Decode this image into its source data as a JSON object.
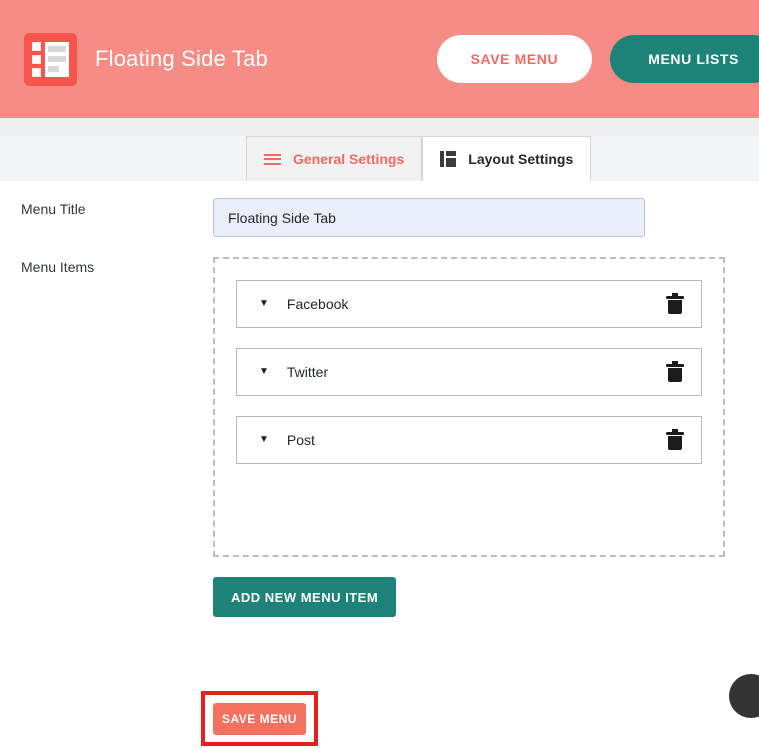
{
  "header": {
    "brand_title": "Floating Side Tab",
    "logo_icon": "side-tab-layout-icon",
    "background_color": "#f58c85",
    "buttons": {
      "save_menu_label": "SAVE MENU",
      "menu_lists_label": "MENU LISTS",
      "menu_lists_color": "#1d8277"
    }
  },
  "tabs": [
    {
      "label": "General Settings",
      "icon": "hamburger-icon",
      "active": false,
      "color": "#f26a5f"
    },
    {
      "label": "Layout Settings",
      "icon": "layout-columns-icon",
      "active": true,
      "color": "#23282d"
    }
  ],
  "form": {
    "menu_title": {
      "label": "Menu Title",
      "value": "Floating Side Tab",
      "placeholder": "Menu Title"
    },
    "menu_items": {
      "label": "Menu Items",
      "items": [
        {
          "name": "Facebook",
          "caret_icon": "caret-down-icon",
          "delete_icon": "trash-icon"
        },
        {
          "name": "Twitter",
          "caret_icon": "caret-down-icon",
          "delete_icon": "trash-icon"
        },
        {
          "name": "Post",
          "caret_icon": "caret-down-icon",
          "delete_icon": "trash-icon"
        }
      ]
    },
    "add_item_button_label": "ADD NEW MENU ITEM",
    "save_button_label": "SAVE MENU",
    "save_button_highlight_color": "#e8201d"
  },
  "widgets": {
    "support_bubble_icon": "chat-bubble-icon"
  }
}
